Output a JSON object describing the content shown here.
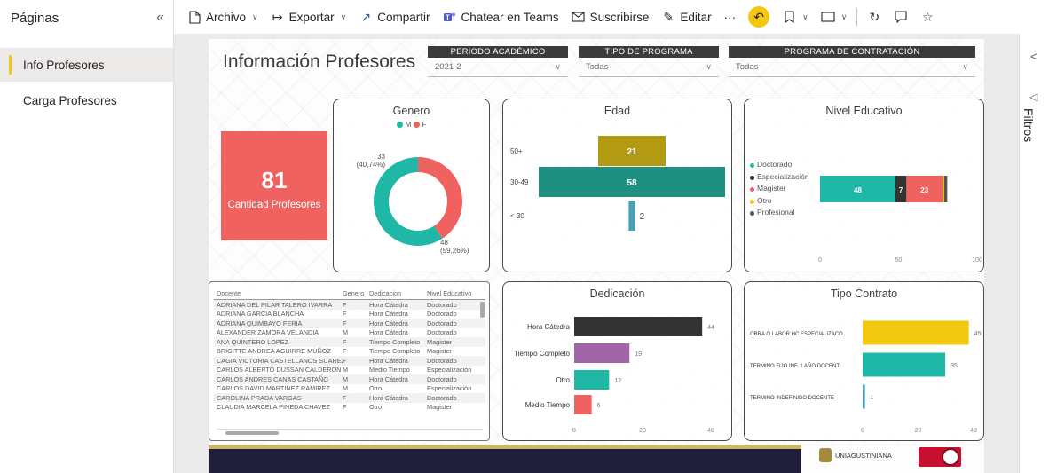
{
  "pages_panel": {
    "title": "Páginas",
    "items": [
      {
        "label": "Info Profesores",
        "active": true
      },
      {
        "label": "Carga Profesores",
        "active": false
      }
    ]
  },
  "toolbar": {
    "archivo": "Archivo",
    "exportar": "Exportar",
    "compartir": "Compartir",
    "teams": "Chatear en Teams",
    "suscribirse": "Suscribirse",
    "editar": "Editar",
    "more": "···"
  },
  "filters_pane": {
    "label": "Filtros"
  },
  "report": {
    "title": "Información Profesores",
    "slicers": [
      {
        "header": "PERIODO ACADÉMICO",
        "value": "2021-2"
      },
      {
        "header": "TIPO DE PROGRAMA",
        "value": "Todas"
      },
      {
        "header": "PROGRAMA DE CONTRATACIÓN",
        "value": "Todas"
      }
    ],
    "kpi": {
      "value": "81",
      "label": "Cantidad Profesores"
    },
    "genero": {
      "title": "Genero",
      "legend": [
        {
          "label": "M",
          "color": "#1fb8a6"
        },
        {
          "label": "F",
          "color": "#f0625f"
        }
      ],
      "label_f_count": "33",
      "label_f_pct": "(40,74%)",
      "label_m_count": "48",
      "label_m_pct": "(59,26%)"
    },
    "edad": {
      "title": "Edad"
    },
    "nivel": {
      "title": "Nivel Educativo",
      "legend": [
        {
          "label": "Doctorado",
          "color": "#1fb8a6"
        },
        {
          "label": "Especialización",
          "color": "#333333"
        },
        {
          "label": "Magister",
          "color": "#f0625f"
        },
        {
          "label": "Otro",
          "color": "#f2c811"
        },
        {
          "label": "Profesional",
          "color": "#555555"
        }
      ]
    },
    "dedicacion": {
      "title": "Dedicación"
    },
    "contrato": {
      "title": "Tipo Contrato"
    },
    "table": {
      "headers": [
        "Docente",
        "Genero",
        "Dedicacion",
        "Nivel Educativo"
      ],
      "rows": [
        [
          "ADRIANA DEL PILAR TALERO IVARRA",
          "F",
          "Hora Cátedra",
          "Doctorado"
        ],
        [
          "ADRIANA GARCIA BLANCHA",
          "F",
          "Hora Cátedra",
          "Doctorado"
        ],
        [
          "ADRIANA QUIMBAYO FERIA",
          "F",
          "Hora Cátedra",
          "Doctorado"
        ],
        [
          "ALEXANDER ZAMORA VELANDIA",
          "M",
          "Hora Cátedra",
          "Doctorado"
        ],
        [
          "ANA QUINTERO LOPEZ",
          "F",
          "Tiempo Completo",
          "Magister"
        ],
        [
          "BRIGITTE ANDREA AGUIRRE MUÑOZ",
          "F",
          "Tiempo Completo",
          "Magister"
        ],
        [
          "CAGIA VICTORIA CASTELLANOS SUAREZ",
          "F",
          "Hora Cátedra",
          "Doctorado"
        ],
        [
          "CARLOS ALBERTO DUSSAN CALDERON",
          "M",
          "Medio Tiempo",
          "Especialización"
        ],
        [
          "CARLOS ANDRES CANAS CASTAÑO",
          "M",
          "Hora Cátedra",
          "Doctorado"
        ],
        [
          "CARLOS DAVID MARTINEZ RAMIREZ",
          "M",
          "Otro",
          "Especialización"
        ],
        [
          "CAROLINA PRADA VARGAS",
          "F",
          "Hora Cátedra",
          "Doctorado"
        ],
        [
          "CLAUDIA MARCELA PINEDA CHAVEZ",
          "F",
          "Otro",
          "Magister"
        ]
      ]
    },
    "footer": {
      "logo_text": "UNIAGUSTINIANA"
    }
  },
  "chart_data": [
    {
      "type": "pie",
      "title": "Genero",
      "categories": [
        "M",
        "F"
      ],
      "values": [
        48,
        33
      ],
      "labels": [
        "48 (59,26%)",
        "33 (40,74%)"
      ],
      "colors": [
        "#1fb8a6",
        "#f0625f"
      ],
      "legend": "top"
    },
    {
      "type": "bar",
      "title": "Edad",
      "orientation": "horizontal",
      "categories": [
        "50+",
        "30-49",
        "< 30"
      ],
      "values": [
        21,
        58,
        2
      ],
      "colors": [
        "#b39a13",
        "#1f8f82",
        "#4aa0b5"
      ]
    },
    {
      "type": "bar",
      "title": "Nivel Educativo",
      "orientation": "horizontal",
      "stacked": true,
      "categories": [
        ""
      ],
      "series": [
        {
          "name": "Doctorado",
          "values": [
            48
          ],
          "color": "#1fb8a6"
        },
        {
          "name": "Especialización",
          "values": [
            7
          ],
          "color": "#333333"
        },
        {
          "name": "Magister",
          "values": [
            23
          ],
          "color": "#f0625f"
        },
        {
          "name": "Otro",
          "values": [
            1
          ],
          "color": "#f2c811"
        },
        {
          "name": "Profesional",
          "values": [
            2
          ],
          "color": "#555555"
        }
      ],
      "xlim": [
        0,
        100
      ],
      "xticks": [
        "0",
        "50",
        "100"
      ],
      "legend": "left"
    },
    {
      "type": "bar",
      "title": "Dedicación",
      "orientation": "horizontal",
      "categories": [
        "Hora Cátedra",
        "Tiempo Completo",
        "Otro",
        "Medio Tiempo"
      ],
      "values": [
        44,
        19,
        12,
        6
      ],
      "colors": [
        "#333333",
        "#a066a8",
        "#1fb8a6",
        "#f0625f"
      ],
      "xlim": [
        0,
        47
      ],
      "xticks": [
        "0",
        "20",
        "40"
      ]
    },
    {
      "type": "bar",
      "title": "Tipo Contrato",
      "orientation": "horizontal",
      "categories": [
        "OBRA O LABOR HC ESPECIALIZACO",
        "TERMINO FIJO INF. 1 AÑO DOCENT",
        "TERMINO INDEFINIDO DOCENTE"
      ],
      "values": [
        45,
        35,
        1
      ],
      "colors": [
        "#f2c811",
        "#1fb8a6",
        "#4aa0b5"
      ],
      "xlim": [
        0,
        47
      ],
      "xticks": [
        "0",
        "20",
        "40"
      ]
    }
  ]
}
